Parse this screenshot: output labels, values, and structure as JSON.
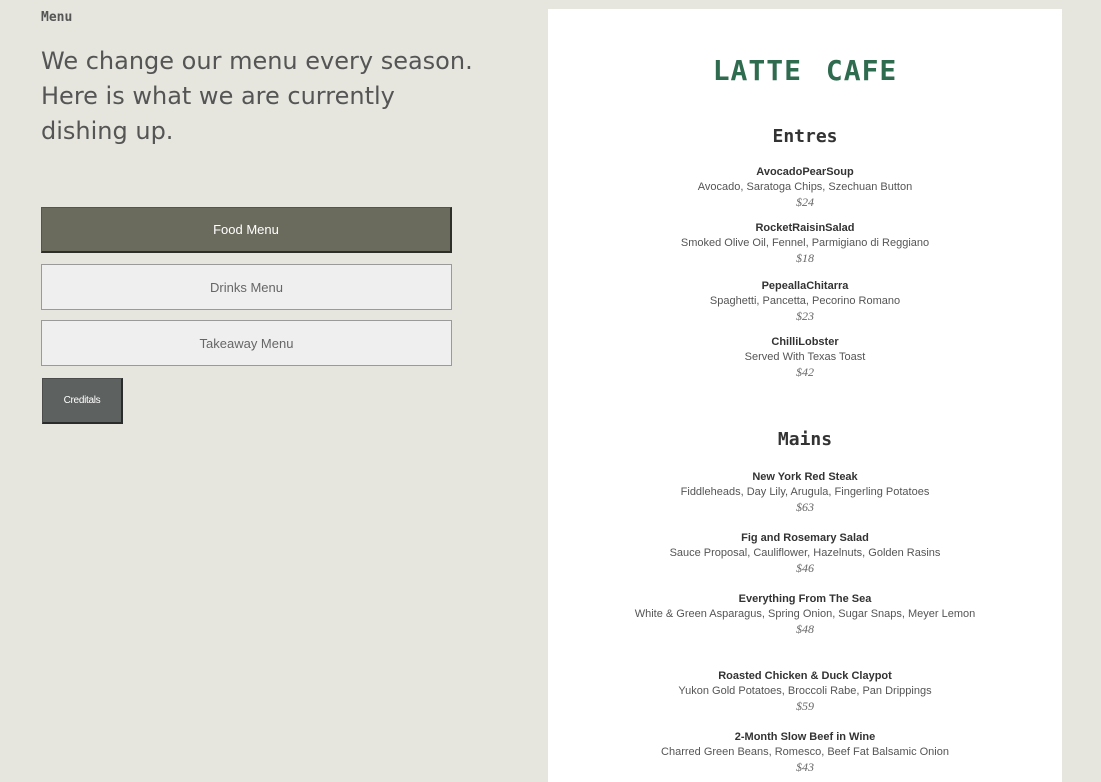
{
  "left_panel": {
    "section_label": "Menu",
    "intro": "We change our menu every season. Here is what we are currently dishing up.",
    "buttons": {
      "food": "Food Menu",
      "drinks": "Drinks Menu",
      "takeaway": "Takeaway Menu",
      "credits": "Creditals"
    }
  },
  "menu_card": {
    "title": "LATTE  CAFE",
    "categories": [
      {
        "name": "Entres",
        "items": [
          {
            "name": "AvocadoPearSoup",
            "desc": "Avocado, Saratoga Chips, Szechuan Button",
            "price": "$24"
          },
          {
            "name": "RocketRaisinSalad",
            "desc": "Smoked Olive Oil, Fennel, Parmigiano di Reggiano",
            "price": "$18"
          },
          {
            "name": "PepeallaChitarra",
            "desc": "Spaghetti, Pancetta, Pecorino Romano",
            "price": "$23"
          },
          {
            "name": "ChilliLobster",
            "desc": "Served With Texas Toast",
            "price": "$42"
          }
        ]
      },
      {
        "name": "Mains",
        "items": [
          {
            "name": "New York Red Steak",
            "desc": "Fiddleheads, Day Lily, Arugula, Fingerling Potatoes",
            "price": "$63"
          },
          {
            "name": "Fig and Rosemary Salad",
            "desc": "Sauce Proposal, Cauliflower, Hazelnuts, Golden Rasins",
            "price": "$46"
          },
          {
            "name": "Everything From The Sea",
            "desc": "White & Green Asparagus, Spring Onion, Sugar Snaps, Meyer Lemon",
            "price": "$48"
          },
          {
            "name": "Roasted Chicken & Duck Claypot",
            "desc": "Yukon Gold Potatoes, Broccoli Rabe, Pan Drippings",
            "price": "$59"
          },
          {
            "name": "2-Month Slow Beef in Wine",
            "desc": "Charred Green Beans, Romesco, Beef Fat Balsamic Onion",
            "price": "$43"
          }
        ]
      }
    ]
  },
  "colors": {
    "background": "#e6e6df",
    "active_button": "#6b6b5d",
    "credits_button": "#5d615f",
    "cafe_title": "#2f6b4e"
  }
}
